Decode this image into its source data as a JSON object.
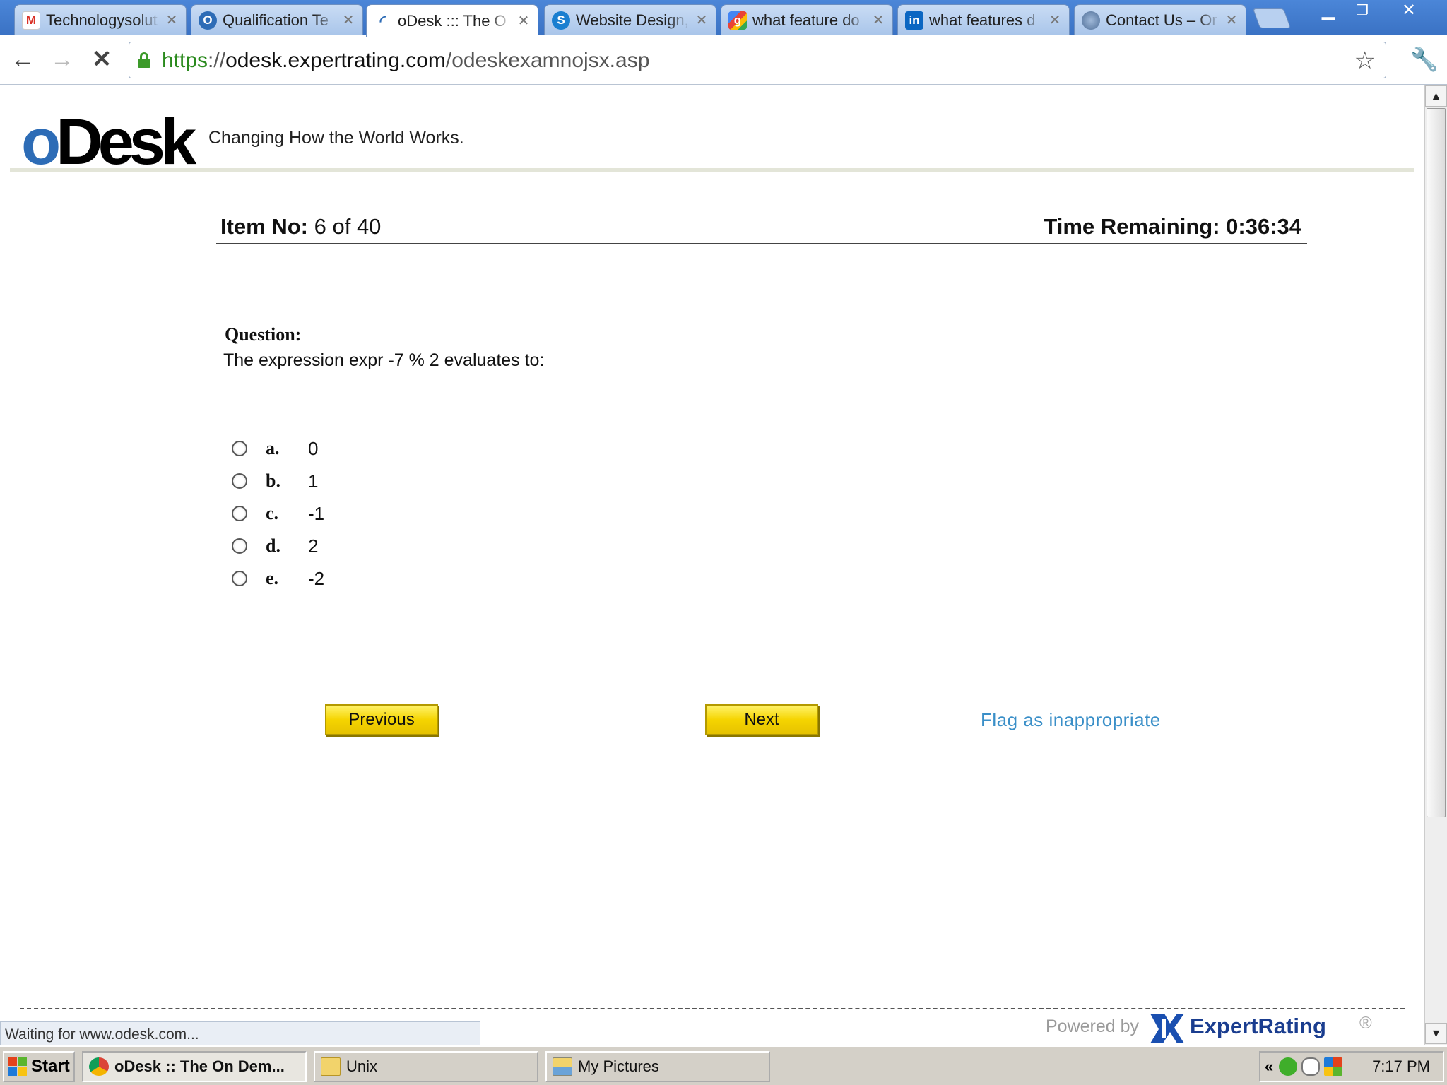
{
  "browser": {
    "tabs": [
      {
        "title": "Technologysolut",
        "favicon": "gmail-icon",
        "active": false
      },
      {
        "title": "Qualification Te",
        "favicon": "odesk-icon",
        "active": false
      },
      {
        "title": "oDesk ::: The O",
        "favicon": "loading-spinner-icon",
        "active": true
      },
      {
        "title": "Website Design,",
        "favicon": "skype-icon",
        "active": false
      },
      {
        "title": "what feature do",
        "favicon": "google-icon",
        "active": false
      },
      {
        "title": "what features d",
        "favicon": "linkedin-icon",
        "active": false
      },
      {
        "title": "Contact Us – Or",
        "favicon": "globe-icon",
        "active": false
      }
    ],
    "url": {
      "scheme": "https",
      "host": "odesk.expertrating.com",
      "path": "/odeskexamnojsx.asp"
    },
    "status_text": "Waiting for www.odesk.com..."
  },
  "page": {
    "logo": {
      "o": "o",
      "desk": "Desk"
    },
    "tagline": "Changing How the World Works.",
    "item_label": "Item No:",
    "item_value": "6 of 40",
    "time_remaining": "Time Remaining: 0:36:34",
    "question_label": "Question:",
    "question_text": "The expression expr -7 % 2 evaluates to:",
    "options": [
      {
        "letter": "a.",
        "value": "0"
      },
      {
        "letter": "b.",
        "value": "1"
      },
      {
        "letter": "c.",
        "value": "-1"
      },
      {
        "letter": "d.",
        "value": "2"
      },
      {
        "letter": "e.",
        "value": "-2"
      }
    ],
    "previous_label": "Previous",
    "next_label": "Next",
    "flag_label": "Flag as inappropriate",
    "powered_by": "Powered by",
    "expertrating": "ExpertRating",
    "registered": "®"
  },
  "taskbar": {
    "start_label": "Start",
    "tasks": [
      {
        "label": "oDesk :: The On Dem...",
        "icon": "chrome-icon",
        "active": true
      },
      {
        "label": "Unix",
        "icon": "folder-icon",
        "active": false
      },
      {
        "label": "My Pictures",
        "icon": "pictures-icon",
        "active": false
      }
    ],
    "clock": "7:17 PM"
  },
  "colors": {
    "accent_blue": "#2d6cb6",
    "button_yellow": "#f5d400",
    "link_blue": "#3a8fc8",
    "secure_green": "#2a8a1d"
  }
}
